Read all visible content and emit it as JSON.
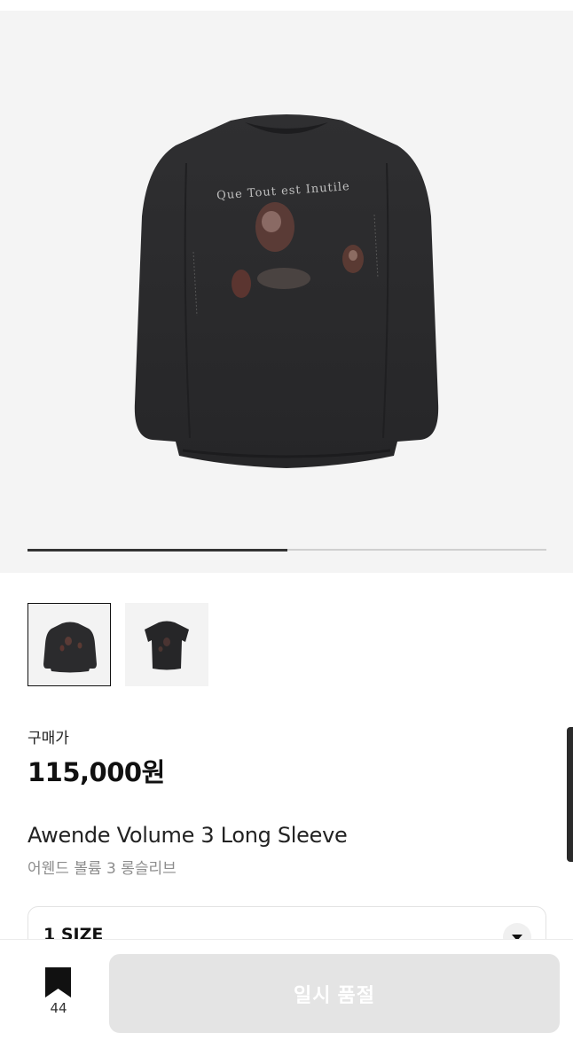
{
  "product_image": {
    "print_text": "Que Tout est Inutile",
    "gallery_progress": 0.5
  },
  "thumbnails": [
    {
      "name": "long-sleeve-front",
      "selected": true
    },
    {
      "name": "short-sleeve-variant",
      "selected": false
    }
  ],
  "price": {
    "label": "구매가",
    "value": "115,000원"
  },
  "product": {
    "name_en": "Awende Volume 3 Long Sleeve",
    "name_ko": "어웬드 볼륨 3 롱슬리브"
  },
  "size_select": {
    "selected": "1 SIZE",
    "icon": "chevron-down-icon"
  },
  "bottom_bar": {
    "bookmark_icon": "bookmark-icon",
    "bookmark_count": "44",
    "button_label": "일시 품절"
  },
  "colors": {
    "shirt": "#2b2b2d",
    "button_disabled": "#e4e4e4",
    "text_secondary": "#8d8d8d"
  }
}
